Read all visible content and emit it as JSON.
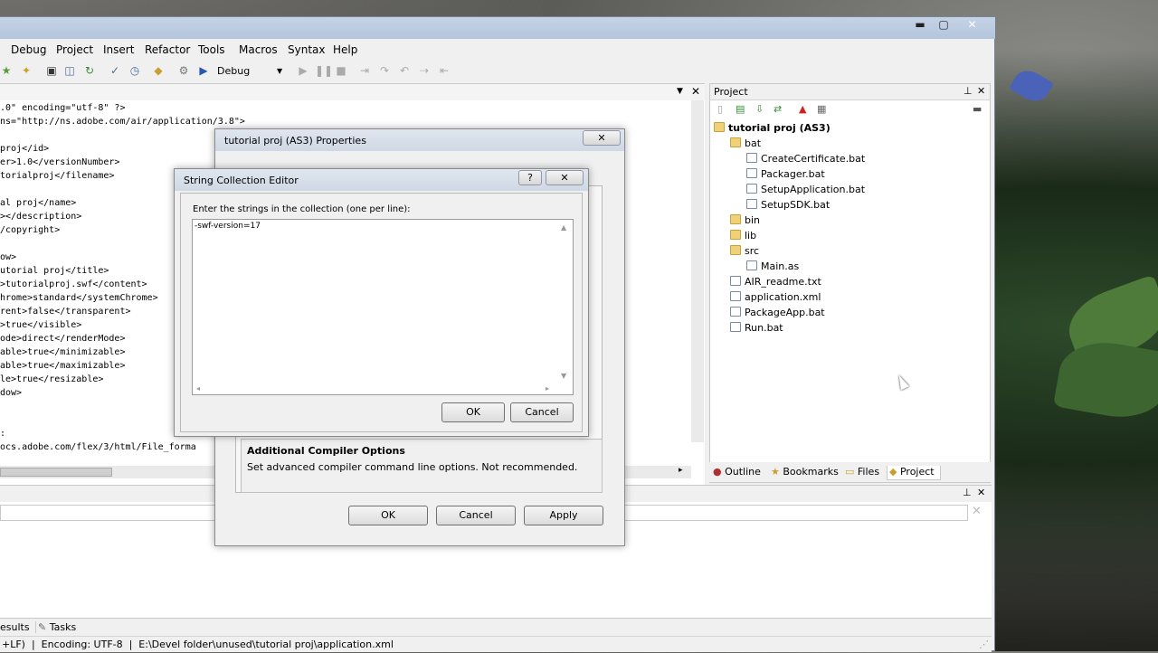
{
  "menu": [
    "Debug",
    "Project",
    "Insert",
    "Refactor",
    "Tools",
    "Macros",
    "Syntax",
    "Help"
  ],
  "toolbar": {
    "config": "Debug"
  },
  "editor": {
    "lines": [
      ".0\" encoding=\"utf-8\" ?>",
      "ns=\"http://ns.adobe.com/air/application/3.8\">",
      "",
      "proj</id>",
      "er>1.0</versionNumber>",
      "torialproj</filename>",
      "",
      "al proj</name>",
      "></description>",
      "/copyright>",
      "",
      "ow>",
      "utorial proj</title>",
      ">tutorialproj.swf</content>",
      "hrome>standard</systemChrome>",
      "rent>false</transparent>",
      ">true</visible>",
      "ode>direct</renderMode>",
      "able>true</minimizable>",
      "able>true</maximizable>",
      "le>true</resizable>",
      "dow>",
      "",
      "",
      ":",
      "ocs.adobe.com/flex/3/html/File_forma"
    ]
  },
  "project_panel": {
    "title": "Project",
    "root": "tutorial proj (AS3)",
    "items": [
      {
        "label": "bat",
        "kind": "folder",
        "depth": 1
      },
      {
        "label": "CreateCertificate.bat",
        "kind": "file",
        "depth": 2
      },
      {
        "label": "Packager.bat",
        "kind": "file",
        "depth": 2
      },
      {
        "label": "SetupApplication.bat",
        "kind": "file",
        "depth": 2
      },
      {
        "label": "SetupSDK.bat",
        "kind": "file",
        "depth": 2
      },
      {
        "label": "bin",
        "kind": "folder",
        "depth": 1
      },
      {
        "label": "lib",
        "kind": "folder",
        "depth": 1
      },
      {
        "label": "src",
        "kind": "folder",
        "depth": 1
      },
      {
        "label": "Main.as",
        "kind": "file",
        "depth": 2
      },
      {
        "label": "AIR_readme.txt",
        "kind": "file",
        "depth": 1
      },
      {
        "label": "application.xml",
        "kind": "file",
        "depth": 1
      },
      {
        "label": "PackageApp.bat",
        "kind": "file",
        "depth": 1
      },
      {
        "label": "Run.bat",
        "kind": "file",
        "depth": 1
      }
    ],
    "tabs": [
      "Outline",
      "Bookmarks",
      "Files",
      "Project"
    ]
  },
  "bottom_tabs": [
    "esults",
    "Tasks"
  ],
  "status": "+LF)  |  Encoding: UTF-8  |  E:\\Devel folder\\unused\\tutorial proj\\application.xml",
  "properties_dialog": {
    "title": "tutorial proj (AS3) Properties",
    "help_title": "Additional Compiler Options",
    "help_text": "Set advanced compiler command line options. Not recommended.",
    "ok": "OK",
    "cancel": "Cancel",
    "apply": "Apply"
  },
  "string_editor": {
    "title": "String Collection Editor",
    "prompt": "Enter the strings in the collection (one per line):",
    "value": "-swf-version=17",
    "ok": "OK",
    "cancel": "Cancel"
  }
}
